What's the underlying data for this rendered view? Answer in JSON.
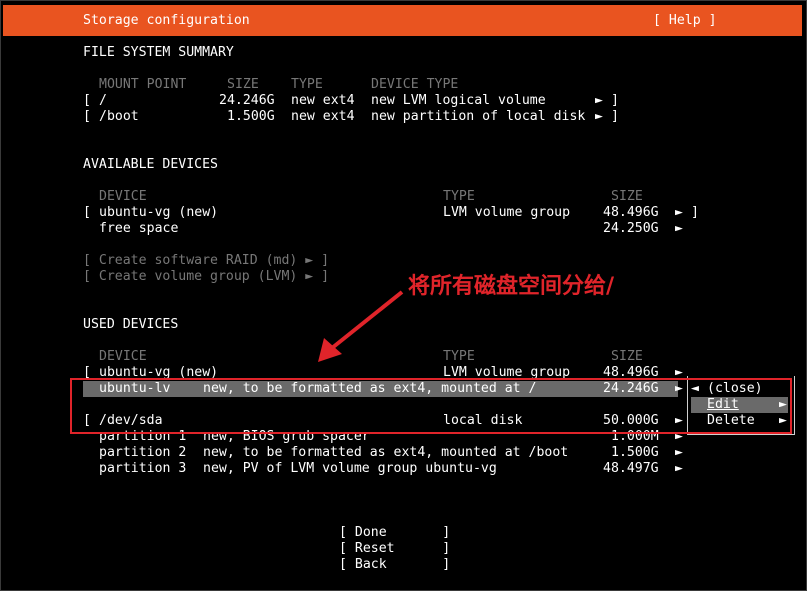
{
  "header": {
    "title": "Storage configuration",
    "help": "[ Help ]"
  },
  "fs_summary": {
    "title": "FILE SYSTEM SUMMARY",
    "columns": [
      "MOUNT POINT",
      "SIZE",
      "TYPE",
      "DEVICE TYPE"
    ],
    "rows": [
      {
        "open": "[",
        "mount": "/",
        "size": "24.246G",
        "type": "new ext4",
        "device_type": "new LVM logical volume",
        "arrow": "►",
        "close": "]"
      },
      {
        "open": "[",
        "mount": "/boot",
        "size": "1.500G",
        "type": "new ext4",
        "device_type": "new partition of local disk",
        "arrow": "►",
        "close": "]"
      }
    ]
  },
  "available": {
    "title": "AVAILABLE DEVICES",
    "columns": [
      "DEVICE",
      "TYPE",
      "SIZE"
    ],
    "rows": [
      {
        "open": "[",
        "device": "ubuntu-vg (new)",
        "type": "LVM volume group",
        "size": "48.496G",
        "arrow": "►",
        "close": "]"
      },
      {
        "device": "free space",
        "size": "24.250G",
        "arrow": "►"
      }
    ],
    "actions": [
      "[ Create software RAID (md) ► ]",
      "[ Create volume group (LVM) ► ]"
    ]
  },
  "annotation": "将所有磁盘空间分给/",
  "used": {
    "title": "USED DEVICES",
    "columns": [
      "DEVICE",
      "TYPE",
      "SIZE"
    ],
    "vg": {
      "open": "[",
      "device": "ubuntu-vg (new)",
      "type": "LVM volume group",
      "size": "48.496G",
      "arrow": "►"
    },
    "lv": {
      "device": "ubuntu-lv",
      "desc": "new, to be formatted as ext4, mounted at /",
      "size": "24.246G",
      "arrow": "►"
    },
    "sda": {
      "open": "[",
      "device": "/dev/sda",
      "type": "local disk",
      "size": "50.000G",
      "arrow": "►"
    },
    "partitions": [
      {
        "name": "partition 1",
        "desc": "new, BIOS grub spacer",
        "size": "1.000M",
        "arrow": "►"
      },
      {
        "name": "partition 2",
        "desc": "new, to be formatted as ext4, mounted at /boot",
        "size": "1.500G",
        "arrow": "►"
      },
      {
        "name": "partition 3",
        "desc": "new, PV of LVM volume group ubuntu-vg",
        "size": "48.497G",
        "arrow": "►"
      }
    ]
  },
  "context_menu": {
    "items": [
      {
        "label": "(close)",
        "left_arrow": "◄"
      },
      {
        "label": "Edit",
        "right_arrow": "►"
      },
      {
        "label": "Delete",
        "right_arrow": "►"
      }
    ]
  },
  "buttons": [
    "[ Done       ]",
    "[ Reset      ]",
    "[ Back       ]"
  ],
  "colors": {
    "accent": "#e95420",
    "annotation": "#e0242a",
    "selection": "#6a6a6a",
    "dim": "#777777"
  }
}
